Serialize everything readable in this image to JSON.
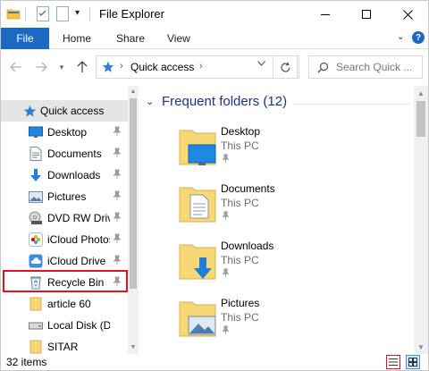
{
  "window": {
    "title": "File Explorer"
  },
  "ribbon": {
    "tabs": [
      "File",
      "Home",
      "Share",
      "View"
    ],
    "help": "?"
  },
  "address": {
    "location": "Quick access"
  },
  "search": {
    "placeholder": "Search Quick ..."
  },
  "sidebar": {
    "items": [
      {
        "label": "Quick access",
        "icon": "star-icon",
        "pinned": false
      },
      {
        "label": "Desktop",
        "icon": "desktop-icon",
        "pinned": true
      },
      {
        "label": "Documents",
        "icon": "documents-icon",
        "pinned": true
      },
      {
        "label": "Downloads",
        "icon": "downloads-icon",
        "pinned": true
      },
      {
        "label": "Pictures",
        "icon": "pictures-icon",
        "pinned": true
      },
      {
        "label": "DVD RW Drive",
        "icon": "dvd-drive-icon",
        "pinned": true
      },
      {
        "label": "iCloud Photos",
        "icon": "icloud-photos-icon",
        "pinned": true
      },
      {
        "label": "iCloud Drive",
        "icon": "icloud-drive-icon",
        "pinned": true
      },
      {
        "label": "Recycle Bin",
        "icon": "recycle-bin-icon",
        "pinned": true
      },
      {
        "label": "article 60",
        "icon": "folder-icon",
        "pinned": false
      },
      {
        "label": "Local Disk (D:)",
        "icon": "drive-icon",
        "pinned": false
      },
      {
        "label": "SITAR",
        "icon": "folder-icon",
        "pinned": false
      }
    ],
    "highlighted": "Recycle Bin"
  },
  "main": {
    "group_header": "Frequent folders (12)",
    "folders": [
      {
        "name": "Desktop",
        "location": "This PC",
        "icon": "desktop-folder-icon"
      },
      {
        "name": "Documents",
        "location": "This PC",
        "icon": "documents-folder-icon"
      },
      {
        "name": "Downloads",
        "location": "This PC",
        "icon": "downloads-folder-icon"
      },
      {
        "name": "Pictures",
        "location": "This PC",
        "icon": "pictures-folder-icon"
      }
    ]
  },
  "status": {
    "item_count": "32 items"
  },
  "colors": {
    "accent": "#1a69c4",
    "highlight_border": "#e81123",
    "header_text": "#1e3287",
    "folder_yellow": "#f8d775"
  }
}
